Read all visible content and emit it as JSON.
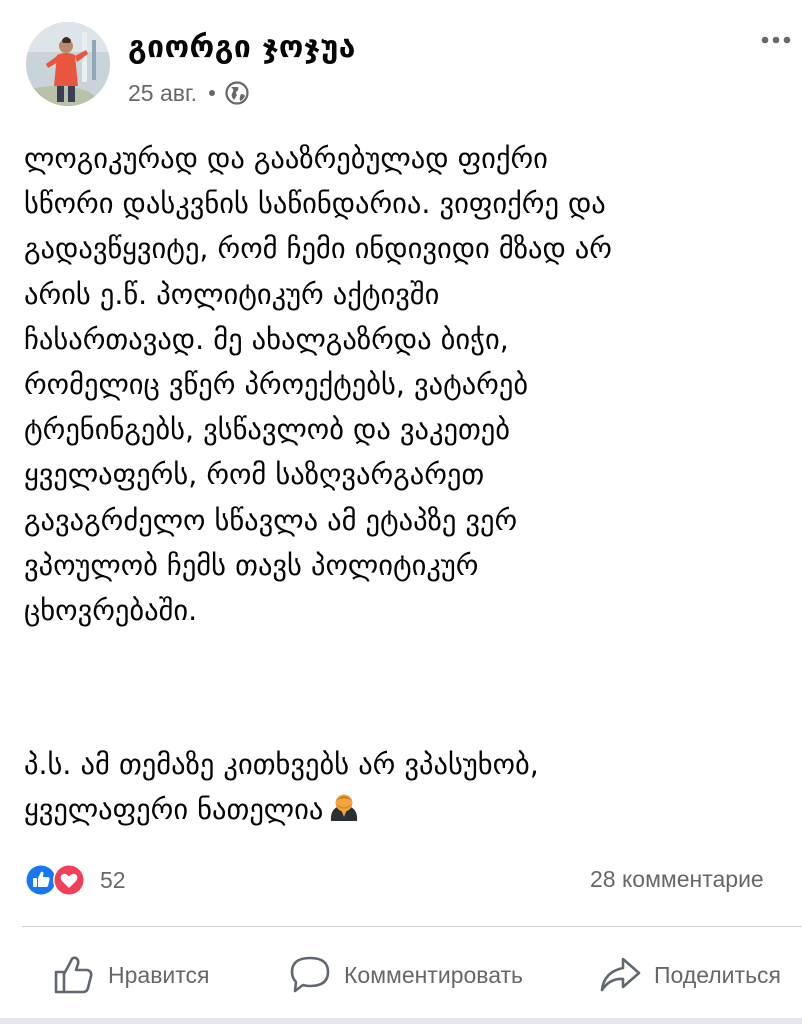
{
  "post": {
    "author": "გიორგი ჯოჯუა",
    "date": "25 авг.",
    "privacy_icon": "globe-icon",
    "body_lines": [
      "ლოგიკურად და გააზრებულად ფიქრი",
      "სწორი დასკვნის საწინდარია. ვიფიქრე და",
      "გადავწყვიტე, რომ ჩემი ინდივიდი მზად არ",
      "არის ე.წ. პოლიტიკურ აქტივში",
      "ჩასართავად. მე ახალგაზრდა ბიჭი,",
      "რომელიც ვწერ პროექტებს, ვატარებ",
      "ტრენინგებს, ვსწავლობ და ვაკეთებ",
      "ყველაფერს, რომ საზღვარგარეთ",
      "გავაგრძელო სწავლა ამ ეტაპზე ვერ",
      "ვპოულობ ჩემს თავს პოლიტიკურ",
      "ცხოვრებაში."
    ],
    "ps_lines": [
      "პ.ს. ამ თემაზე კითხვებს არ ვპასუხობ,",
      "ყველაფერი ნათელია"
    ],
    "emoji": "person-bowing-emoji"
  },
  "reactions": {
    "count": "52",
    "icons": [
      "like-reaction-icon",
      "love-reaction-icon"
    ],
    "like_color": "#1877f2",
    "love_color": "#f33e58"
  },
  "comments_label": "28 комментарие",
  "actions": {
    "like_label": "Нравится",
    "comment_label": "Комментировать",
    "share_label": "Поделиться"
  },
  "colors": {
    "secondary_text": "#65676b",
    "divider": "#ced0d4"
  }
}
